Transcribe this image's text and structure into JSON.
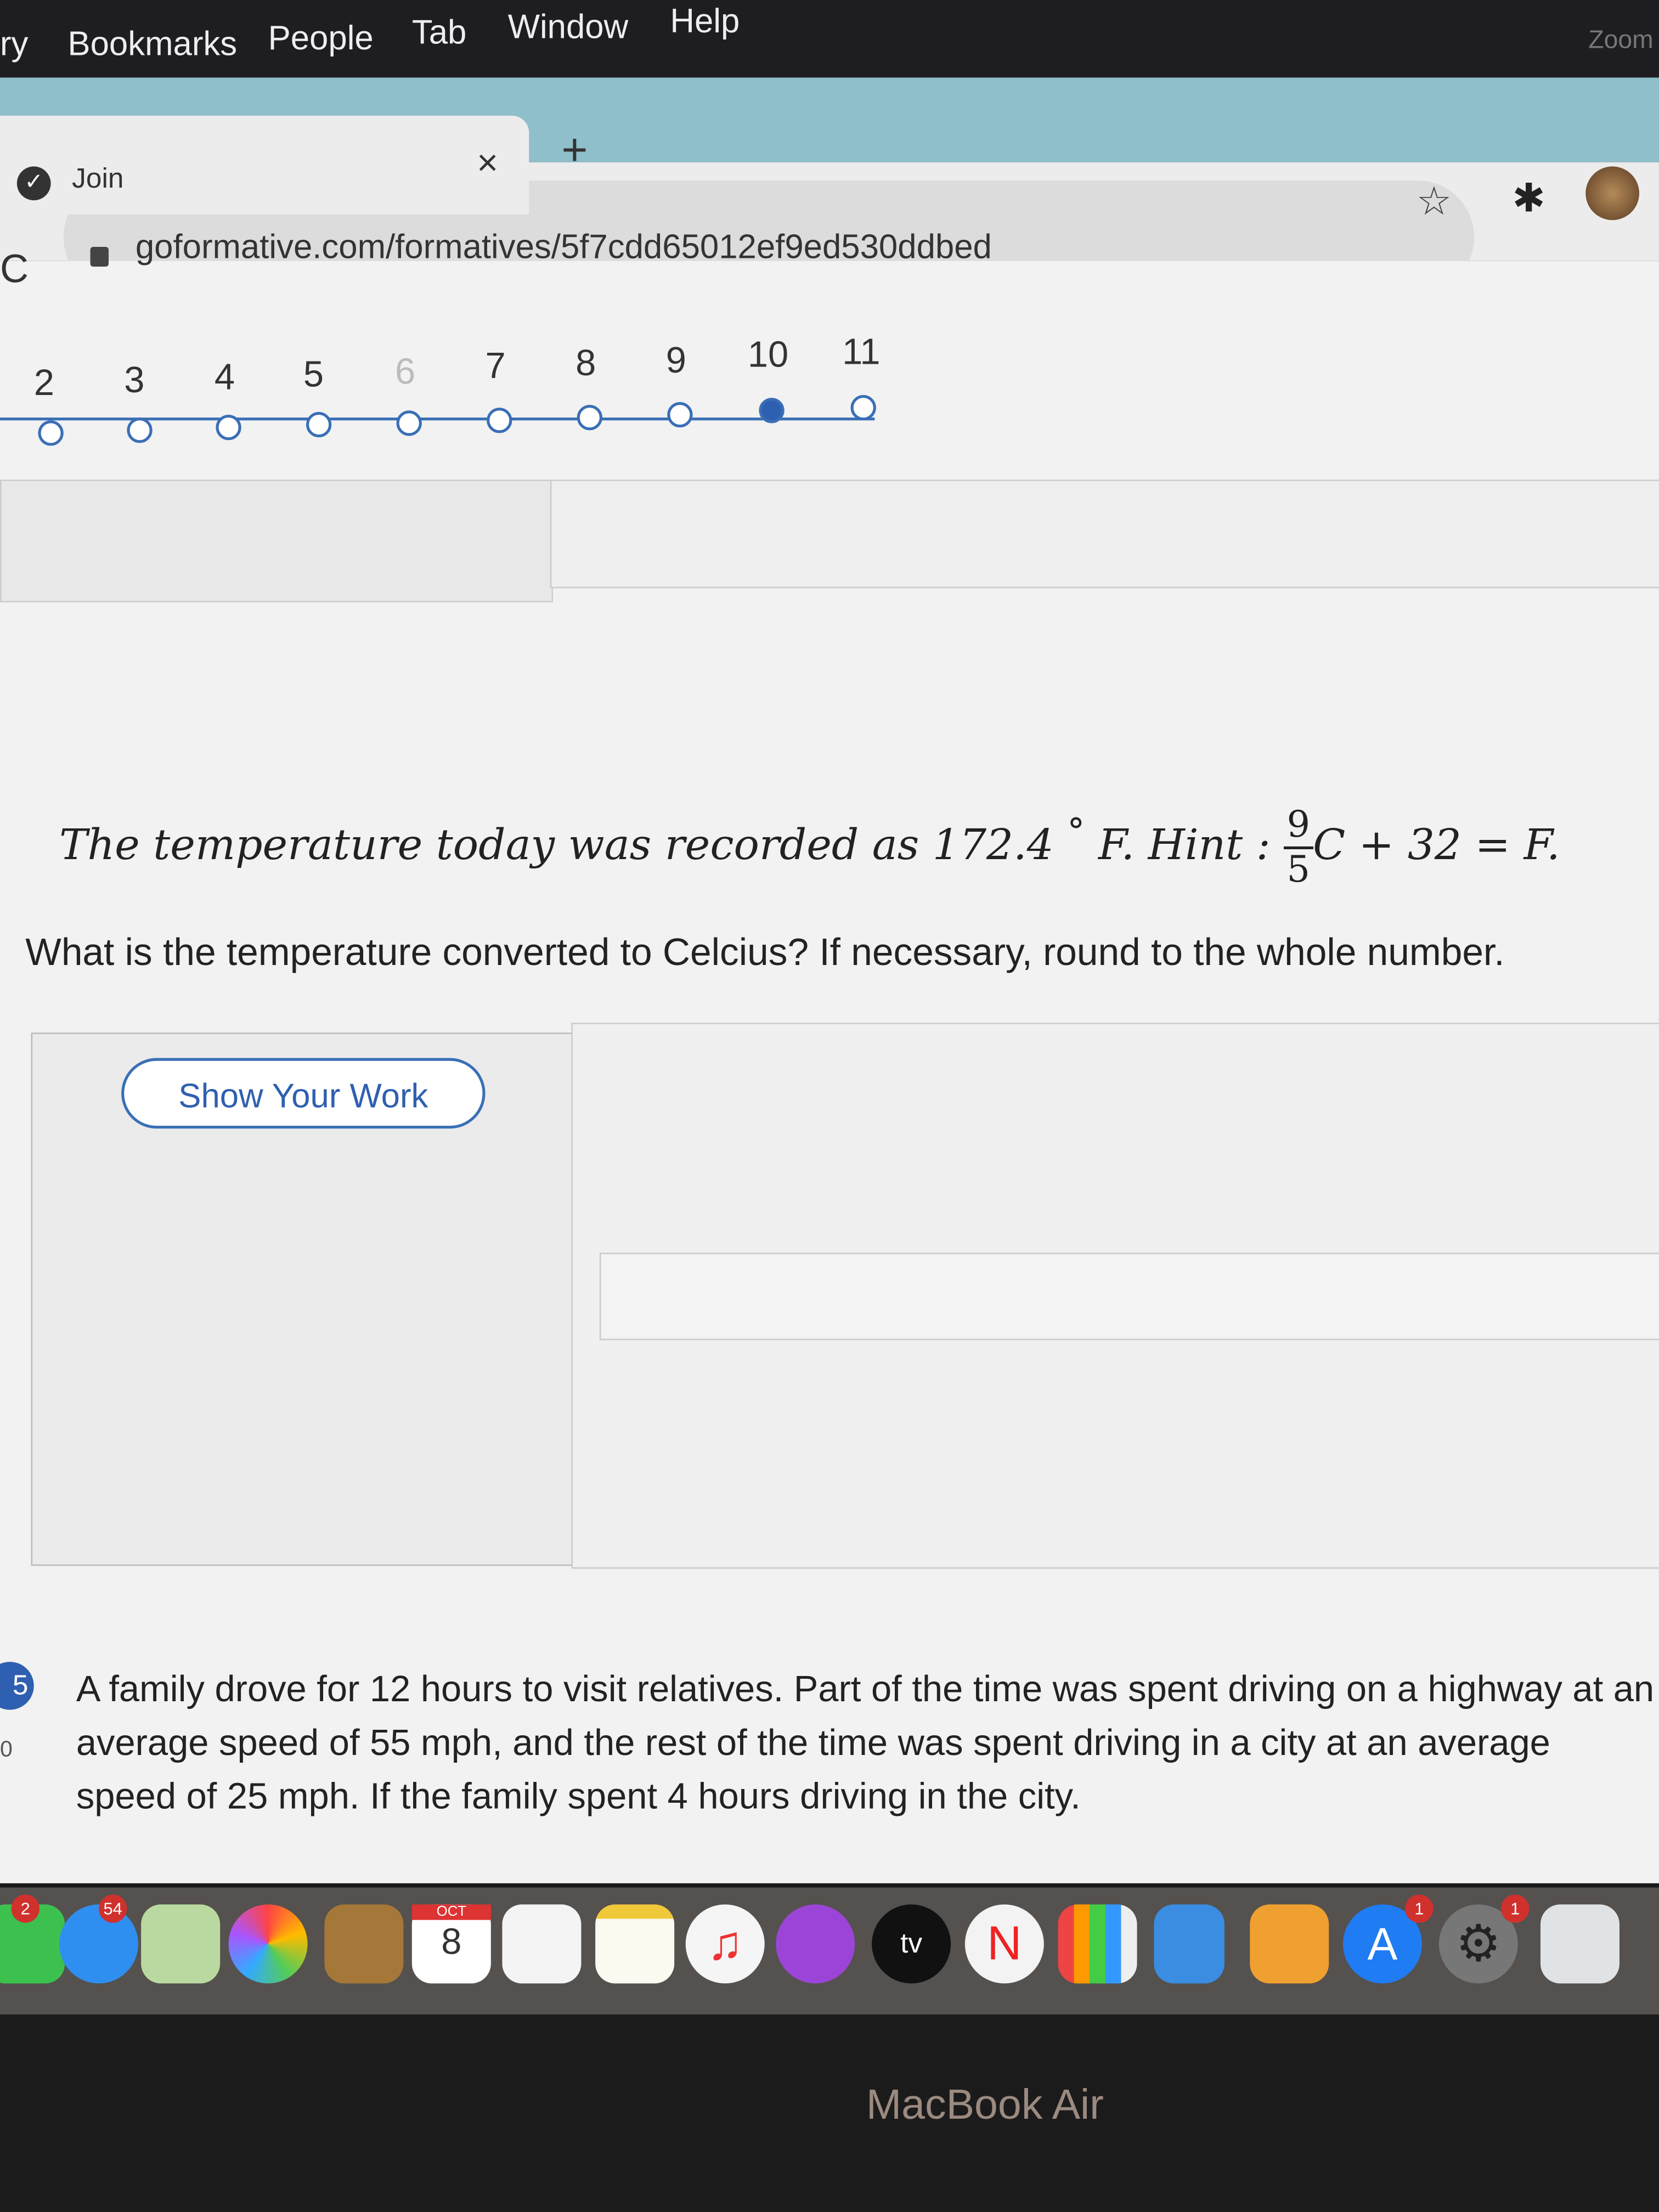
{
  "menubar": {
    "items": [
      "ry",
      "Bookmarks",
      "People",
      "Tab",
      "Window",
      "Help"
    ],
    "right_label": "Zoom"
  },
  "browser": {
    "tab_title": "Join",
    "tab_close": "×",
    "new_tab": "+",
    "url": "goformative.com/formatives/5f7cdd65012ef9ed530ddbed",
    "icons": [
      "reload-icon",
      "lock-icon",
      "star-icon",
      "extensions-icon",
      "avatar"
    ]
  },
  "progress": {
    "steps": [
      "2",
      "3",
      "4",
      "5",
      "6",
      "7",
      "8",
      "9",
      "10",
      "11"
    ],
    "current": "10",
    "accent": "#2f5fb0"
  },
  "question": {
    "text_before": "The temperature today was recorded as 172.4",
    "degree": "°",
    "unit": "F.",
    "hint_label": "Hint :",
    "hint_num": "9",
    "hint_den": "5",
    "hint_rest": "C + 32 = F.",
    "prompt": "What is the temperature converted to Celcius? If necessary, round to the whole number.",
    "show_work_label": "Show Your Work"
  },
  "next_question": {
    "number": "5",
    "points": "0",
    "text": "A family drove for 12 hours to visit relatives. Part of the time was spent driving on a highway at an average speed of 55 mph, and the rest of the time was spent driving in a city at an average speed of 25 mph. If the family spent 4 hours driving in the city."
  },
  "dock": {
    "apps": [
      "FaceTime",
      "Messages",
      "Maps",
      "Photos",
      "Contacts",
      "Calendar",
      "Reminders",
      "Notes",
      "Music",
      "Podcasts",
      "TV",
      "News",
      "Numbers",
      "Keynote",
      "Pages",
      "App Store",
      "System Preferences",
      "Preview"
    ],
    "badges": {
      "facetime": "2",
      "messages": "54",
      "appstore": "1",
      "sysprefs": "1"
    },
    "calendar_month": "OCT",
    "calendar_day": "8",
    "tv_label": "tv"
  },
  "device": {
    "brand": "MacBook Air"
  }
}
